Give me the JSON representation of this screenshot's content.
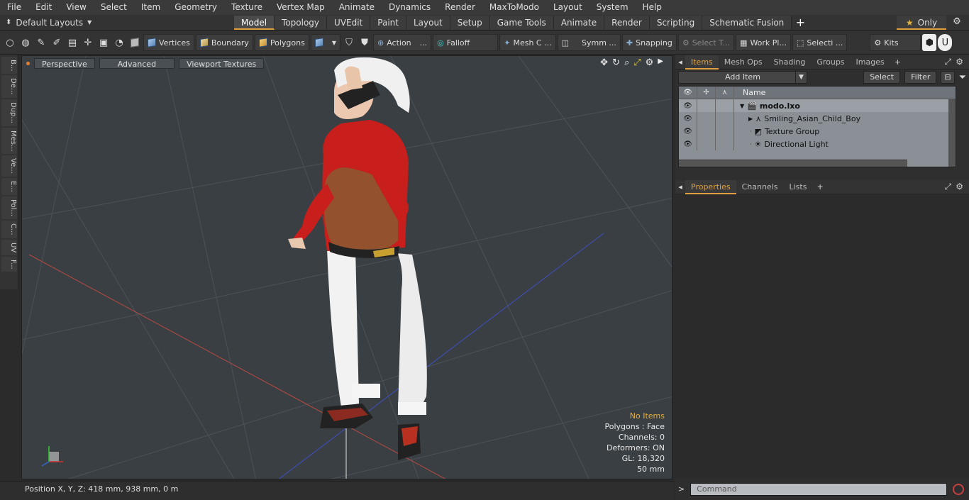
{
  "menu": [
    "File",
    "Edit",
    "View",
    "Select",
    "Item",
    "Geometry",
    "Texture",
    "Vertex Map",
    "Animate",
    "Dynamics",
    "Render",
    "MaxToModo",
    "Layout",
    "System",
    "Help"
  ],
  "layout_selector": "Default Layouts",
  "layout_tabs": [
    {
      "label": "Model",
      "active": true
    },
    {
      "label": "Topology"
    },
    {
      "label": "UVEdit"
    },
    {
      "label": "Paint"
    },
    {
      "label": "Layout"
    },
    {
      "label": "Setup"
    },
    {
      "label": "Game Tools"
    },
    {
      "label": "Animate"
    },
    {
      "label": "Render"
    },
    {
      "label": "Scripting"
    },
    {
      "label": "Schematic Fusion"
    }
  ],
  "only_label": "Only",
  "toolbar": {
    "vertices": "Vertices",
    "boundary": "Boundary",
    "polygons": "Polygons",
    "action": "Action",
    "falloff": "Falloff",
    "mesh": "Mesh C ...",
    "symm": "Symm ...",
    "snapping": "Snapping",
    "select_t": "Select T...",
    "work_pl": "Work Pl...",
    "selecti": "Selecti ...",
    "kits": "Kits"
  },
  "sidebar": [
    "B...",
    "De...",
    "Dup...",
    "Mes...",
    "Ve...",
    "E...",
    "Pol...",
    "C...",
    "UV",
    "F..."
  ],
  "viewport": {
    "perspective": "Perspective",
    "advanced": "Advanced",
    "textures": "Viewport Textures",
    "info": {
      "no_items": "No Items",
      "polygons": "Polygons : Face",
      "channels": "Channels: 0",
      "deformers": "Deformers: ON",
      "gl": "GL: 18,320",
      "scale": "50 mm"
    }
  },
  "status": "Position X, Y, Z:  418 mm, 938 mm, 0 m",
  "items_panel": {
    "tabs": [
      "Items",
      "Mesh Ops",
      "Shading",
      "Groups",
      "Images"
    ],
    "add_item": "Add Item",
    "select": "Select",
    "filter": "Filter",
    "name_col": "Name",
    "rows": [
      {
        "label": "modo.lxo",
        "icon": "scene-icon"
      },
      {
        "label": "Smiling_Asian_Child_Boy",
        "icon": "mesh-icon"
      },
      {
        "label": "Texture Group",
        "icon": "texture-group-icon"
      },
      {
        "label": "Directional Light",
        "icon": "light-icon"
      }
    ]
  },
  "props_panel": {
    "tabs": [
      "Properties",
      "Channels",
      "Lists"
    ]
  },
  "command": {
    "placeholder": "Command"
  },
  "colors": {
    "accent": "#e0a040",
    "viewport_bg": "#3a3f44",
    "shirt": "#c8201e",
    "pants": "#e8e8e8"
  }
}
